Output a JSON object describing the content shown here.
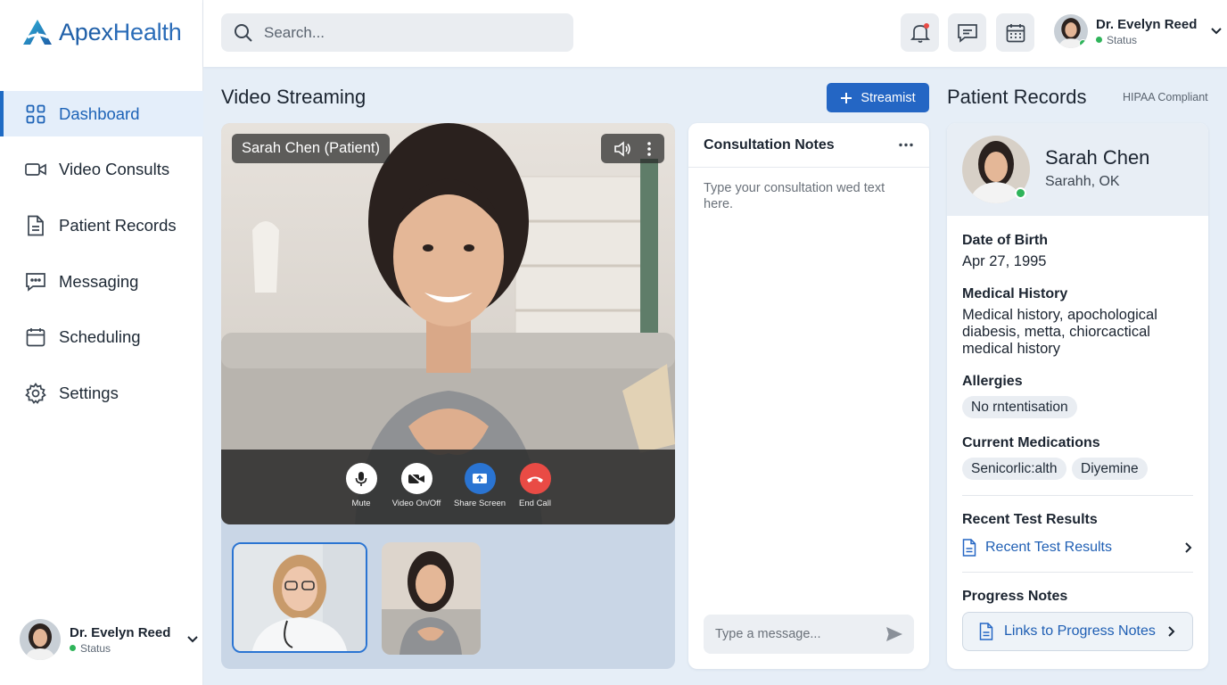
{
  "app": {
    "name": "ApexHealth",
    "name_part1": "Apex",
    "name_part2": "Health"
  },
  "sidebar": {
    "items": [
      {
        "label": "Dashboard",
        "icon": "grid-icon",
        "active": true
      },
      {
        "label": "Video Consults",
        "icon": "video-camera-icon"
      },
      {
        "label": "Patient Records",
        "icon": "document-icon"
      },
      {
        "label": "Messaging",
        "icon": "chat-icon"
      },
      {
        "label": "Scheduling",
        "icon": "calendar-icon"
      },
      {
        "label": "Settings",
        "icon": "gear-icon"
      }
    ],
    "user": {
      "name": "Dr. Evelyn Reed",
      "status": "Status"
    }
  },
  "topbar": {
    "search_placeholder": "Search...",
    "user": {
      "name": "Dr. Evelyn Reed",
      "status": "Status"
    }
  },
  "video": {
    "heading": "Video Streaming",
    "stream_button": "Streamist",
    "participant_label": "Sarah Chen (Patient)",
    "controls": {
      "mute": "Mute",
      "video": "Video On/Off",
      "share": "Share Screen",
      "end": "End Call"
    }
  },
  "notes": {
    "title": "Consultation Notes",
    "body": "Type your consultation wed text here.",
    "message_placeholder": "Type a message..."
  },
  "records": {
    "heading": "Patient Records",
    "compliance": "HIPAA Compliant",
    "patient": {
      "name": "Sarah Chen",
      "location": "Sarahh, OK"
    },
    "dob_label": "Date of Birth",
    "dob": "Apr 27, 1995",
    "history_label": "Medical History",
    "history": "Medical history, apochological diabesis, metta, chiorcactical medical history",
    "allergies_label": "Allergies",
    "allergies": [
      "No rntentisation"
    ],
    "meds_label": "Current Medications",
    "meds": [
      "Senicorlic:alth",
      "Diyemine"
    ],
    "tests_label": "Recent Test Results",
    "tests_link": "Recent Test Results",
    "progress_label": "Progress Notes",
    "progress_link": "Links to Progress Notes"
  },
  "colors": {
    "accent": "#2466c4",
    "end_call": "#e94b45",
    "online": "#2fb45a"
  }
}
